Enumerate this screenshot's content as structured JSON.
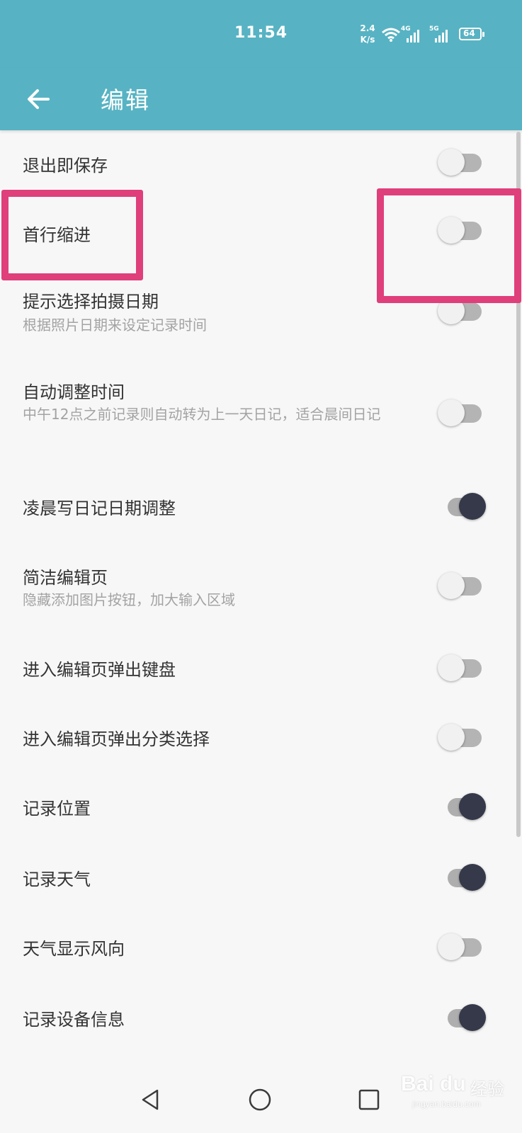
{
  "status_bar": {
    "time": "11:54",
    "net_speed_value": "2.4",
    "net_speed_unit": "K/s",
    "signal_1_label": "4G",
    "signal_2_label": "5G",
    "battery": "64"
  },
  "app_bar": {
    "title": "编辑",
    "background_color": "#57b3c3"
  },
  "settings": [
    {
      "label": "退出即保存",
      "sub": "",
      "on": false
    },
    {
      "label": "首行缩进",
      "sub": "",
      "on": false
    },
    {
      "label": "提示选择拍摄日期",
      "sub": "根据照片日期来设定记录时间",
      "on": false
    },
    {
      "label": "自动调整时间",
      "sub": "中午12点之前记录则自动转为上一天日记，适合晨间日记",
      "on": false
    },
    {
      "label": "凌晨写日记日期调整",
      "sub": "",
      "on": true
    },
    {
      "label": "简洁编辑页",
      "sub": "隐藏添加图片按钮，加大输入区域",
      "on": false
    },
    {
      "label": "进入编辑页弹出键盘",
      "sub": "",
      "on": false
    },
    {
      "label": "进入编辑页弹出分类选择",
      "sub": "",
      "on": false
    },
    {
      "label": "记录位置",
      "sub": "",
      "on": true
    },
    {
      "label": "记录天气",
      "sub": "",
      "on": true
    },
    {
      "label": "天气显示风向",
      "sub": "",
      "on": false
    },
    {
      "label": "记录设备信息",
      "sub": "",
      "on": true
    }
  ],
  "highlight_color": "#df3f7b",
  "watermark": {
    "brand": "Bai du",
    "brand_cn": "经验",
    "url": "jingyan.baidu.com"
  }
}
